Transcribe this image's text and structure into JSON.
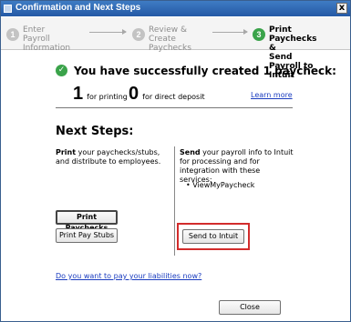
{
  "window": {
    "title": "Confirmation and Next Steps",
    "close_label": "x"
  },
  "steps": [
    {
      "num": "1",
      "label": "Enter Payroll\nInformation"
    },
    {
      "num": "2",
      "label": "Review & Create\nPaychecks"
    },
    {
      "num": "3",
      "label": "Print Paychecks &\nSend Payroll to Intuit"
    }
  ],
  "success": {
    "message": "You have successfully created 1 paycheck:",
    "printing_count": "1",
    "printing_label": "for printing",
    "deposit_count": "0",
    "deposit_label": "for direct deposit",
    "learn_more": "Learn more"
  },
  "next_steps": {
    "heading": "Next Steps:",
    "print_bold": "Print",
    "print_rest": " your paychecks/stubs, and distribute to employees.",
    "send_bold": "Send",
    "send_rest": " your payroll info to Intuit for processing and for integration with these services:",
    "service": "• ViewMyPaycheck"
  },
  "buttons": {
    "print_paychecks": "Print Paychecks",
    "print_pay_stubs": "Print Pay Stubs",
    "send_to_intuit": "Send to Intuit",
    "close": "Close"
  },
  "liabilities_link": "Do you want to pay your liabilities now?",
  "colors": {
    "accent_green": "#3aa34a",
    "highlight_red": "#d22c2c",
    "link_blue": "#1a3cbf",
    "titlebar_blue": "#2459a5"
  }
}
